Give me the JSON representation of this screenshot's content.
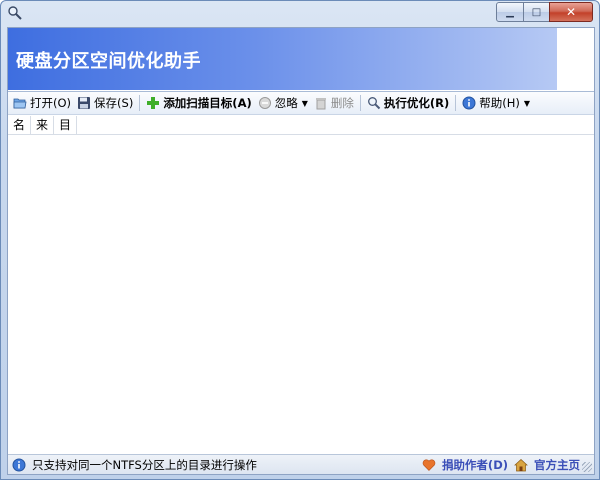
{
  "window": {
    "title_icon": "magnifier-icon",
    "close_glyph": "✕",
    "min_glyph": "▁",
    "max_glyph": "□"
  },
  "banner": {
    "title": "硬盘分区空间优化助手"
  },
  "toolbar": {
    "open": "打开(O)",
    "save": "保存(S)",
    "add_target": "添加扫描目标(A)",
    "ignore": "忽略",
    "delete": "删除",
    "optimize": "执行优化(R)",
    "help": "帮助(H)"
  },
  "columns": [
    "名",
    "来",
    "目"
  ],
  "status": {
    "message": "只支持对同一个NTFS分区上的目录进行操作",
    "donate": "捐助作者(D)",
    "homepage": "官方主页"
  },
  "colors": {
    "banner_start": "#3e6ee0",
    "banner_end": "#b6c9f4",
    "link": "#3b4fb8"
  }
}
